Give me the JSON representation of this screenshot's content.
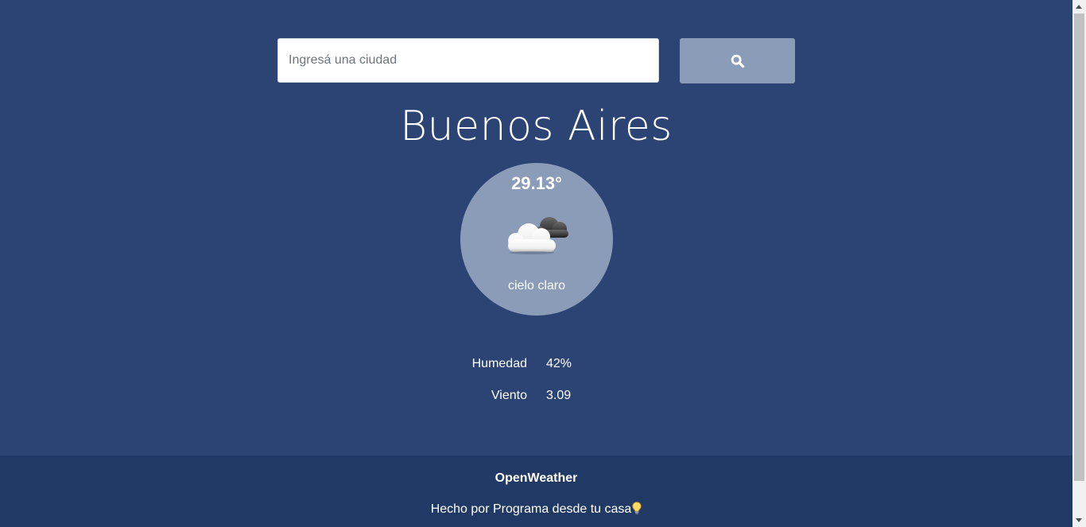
{
  "search": {
    "placeholder": "Ingresá una ciudad",
    "value": "",
    "button_icon": "search-icon"
  },
  "weather": {
    "city": "Buenos Aires",
    "temperature": "29.13°",
    "icon": "cloudy-icon",
    "description": "cielo claro"
  },
  "stats": [
    {
      "label": "Humedad",
      "value": "42%"
    },
    {
      "label": "Viento",
      "value": "3.09"
    }
  ],
  "footer": {
    "brand": "OpenWeather",
    "credit": "Hecho por Programa desde tu casa",
    "credit_icon": "lightbulb-icon"
  },
  "colors": {
    "background": "#2b4473",
    "accent": "#8a9cb8",
    "footer": "#213a65",
    "text": "#ffffff"
  }
}
